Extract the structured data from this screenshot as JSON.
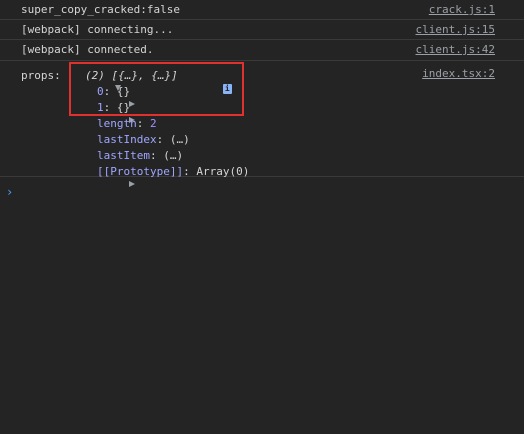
{
  "console": {
    "messages": [
      {
        "text": "super_copy_cracked:false",
        "source": "crack.js:1"
      },
      {
        "text": "[webpack] connecting...",
        "source": "client.js:15"
      },
      {
        "text": "[webpack] connected.",
        "source": "client.js:42"
      }
    ],
    "object_log": {
      "label": "props:",
      "source": "index.tsx:2",
      "summary": "(2) [{…}, {…}]",
      "info_badge": "i",
      "items": [
        {
          "key": "0",
          "value": "{}"
        },
        {
          "key": "1",
          "value": "{}"
        }
      ],
      "length_key": "length",
      "length_value": "2",
      "last_index_key": "lastIndex",
      "last_index_value": "(…)",
      "last_item_key": "lastItem",
      "last_item_value": "(…)",
      "prototype_key": "[[Prototype]]",
      "prototype_value": "Array(0)"
    },
    "prompt_symbol": "›"
  },
  "colors": {
    "background": "#242424",
    "text": "#d5d5d5",
    "link": "#9aa0a6",
    "key": "#9fa6ff",
    "highlight_box": "#e0312f",
    "prompt": "#4f9cf7"
  }
}
